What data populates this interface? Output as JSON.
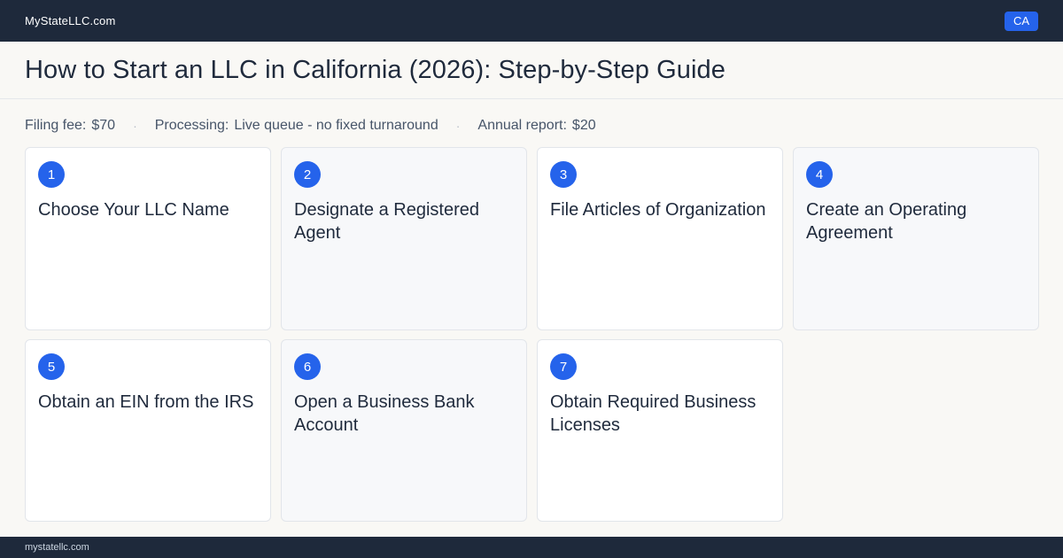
{
  "header": {
    "brand": "MyStateLLC.com",
    "state_badge": "CA"
  },
  "page": {
    "title": "How to Start an LLC in California (2026): Step-by-Step Guide"
  },
  "meta": {
    "filing_fee_label": "Filing fee:",
    "filing_fee_value": "$70",
    "processing_label": "Processing:",
    "processing_value": "Live queue - no fixed turnaround",
    "annual_report_label": "Annual report:",
    "annual_report_value": "$20",
    "separator": "·"
  },
  "steps": [
    {
      "number": "1",
      "title": "Choose Your LLC Name"
    },
    {
      "number": "2",
      "title": "Designate a Registered Agent"
    },
    {
      "number": "3",
      "title": "File Articles of Organization"
    },
    {
      "number": "4",
      "title": "Create an Operating Agreement"
    },
    {
      "number": "5",
      "title": "Obtain an EIN from the IRS"
    },
    {
      "number": "6",
      "title": "Open a Business Bank Account"
    },
    {
      "number": "7",
      "title": "Obtain Required Business Licenses"
    }
  ],
  "footer": {
    "text": "mystatellc.com"
  },
  "colors": {
    "topbar": "#1e293b",
    "accent": "#2563eb",
    "background": "#f9f8f5"
  }
}
